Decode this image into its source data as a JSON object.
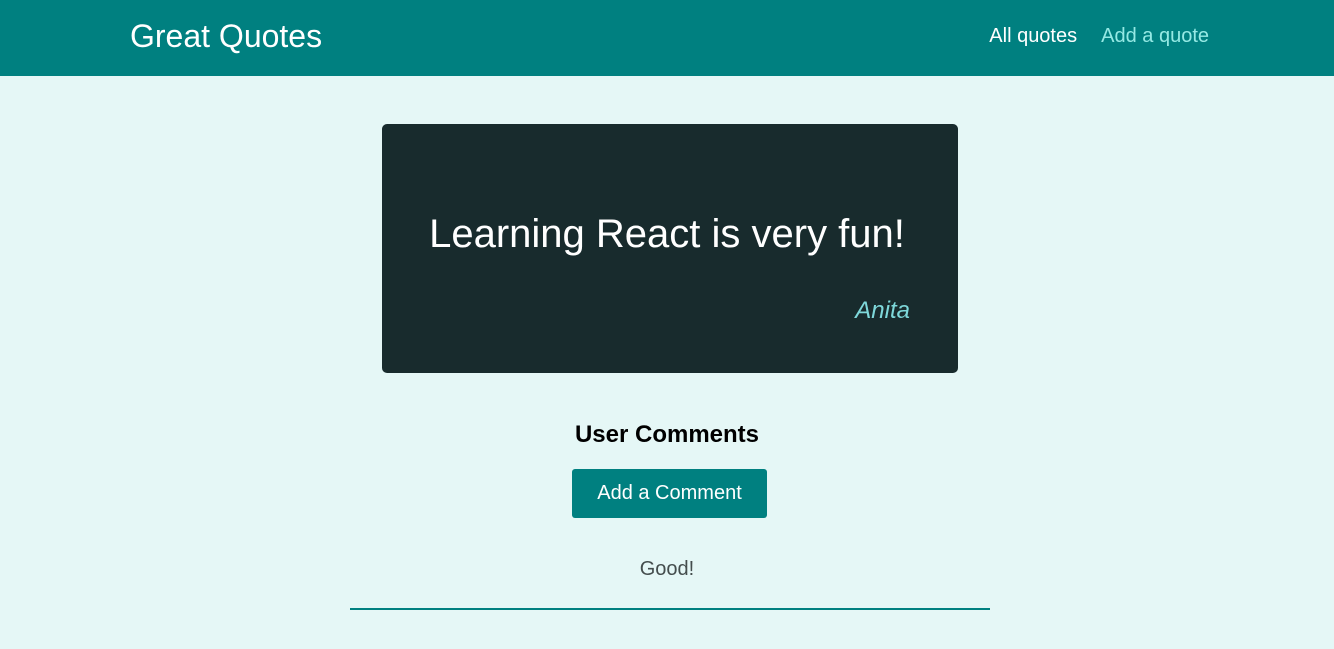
{
  "header": {
    "logo": "Great Quotes",
    "nav": [
      {
        "label": "All quotes",
        "active": false
      },
      {
        "label": "Add a quote",
        "active": true
      }
    ]
  },
  "quote": {
    "text": "Learning React is very fun!",
    "author": "Anita"
  },
  "comments": {
    "title": "User Comments",
    "add_button_label": "Add a Comment",
    "items": [
      {
        "text": "Good!"
      }
    ]
  },
  "colors": {
    "brand": "#008080",
    "page_background": "#e5f7f6",
    "card_background": "#182b2d",
    "active_nav": "#95e9e4",
    "author": "#7ed8da"
  }
}
